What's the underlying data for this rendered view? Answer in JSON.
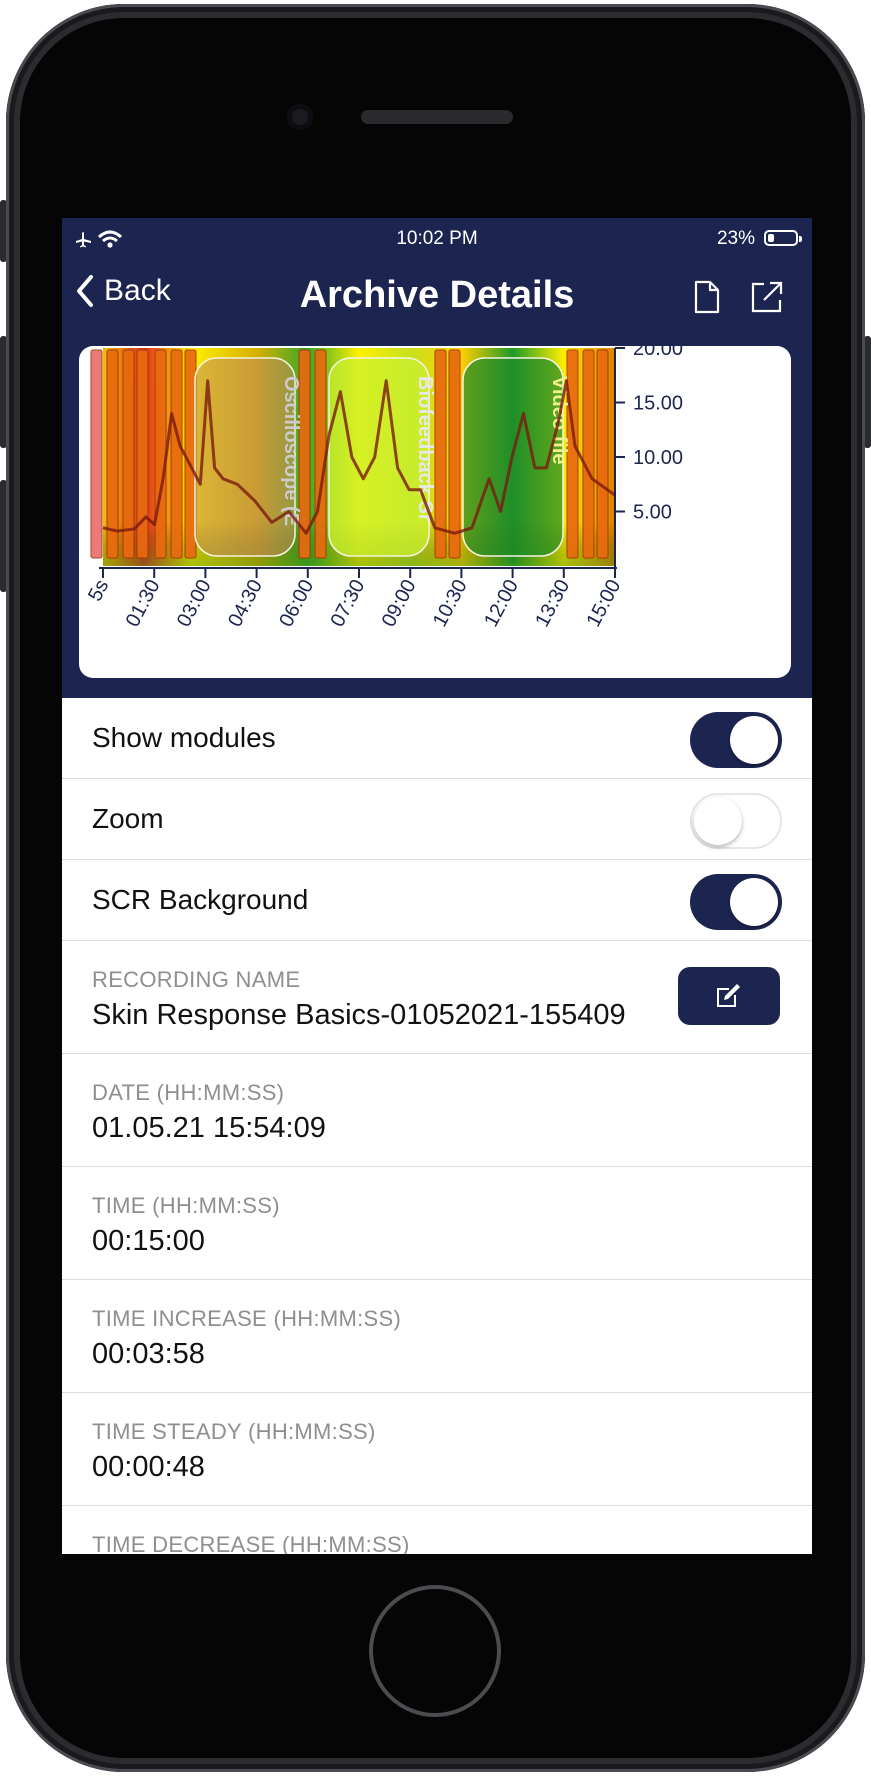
{
  "status": {
    "time": "10:02 PM",
    "battery_pct": "23%",
    "battery_level": 0.23
  },
  "navbar": {
    "back_label": "Back",
    "title": "Archive Details"
  },
  "chart_data": {
    "type": "line",
    "x_tick_labels": [
      "5s",
      "01:30",
      "03:00",
      "04:30",
      "06:00",
      "07:30",
      "09:00",
      "10:30",
      "12:00",
      "13:30",
      "15:00"
    ],
    "y_tick_labels": [
      "20.00",
      "15.00",
      "10.00",
      "5.00"
    ],
    "ylim": [
      0,
      20
    ],
    "xlim_seconds": [
      5,
      900
    ],
    "modules": [
      "Oscilloscope (E",
      "Biofeedback Sr",
      "Video file"
    ],
    "series": [
      {
        "points": [
          [
            5,
            3.5
          ],
          [
            30,
            3.2
          ],
          [
            60,
            3.4
          ],
          [
            80,
            4.5
          ],
          [
            95,
            3.8
          ],
          [
            110,
            8
          ],
          [
            125,
            14
          ],
          [
            140,
            11
          ],
          [
            160,
            9
          ],
          [
            175,
            7.5
          ],
          [
            188,
            17
          ],
          [
            200,
            9
          ],
          [
            215,
            8
          ],
          [
            240,
            7.5
          ],
          [
            270,
            6
          ],
          [
            300,
            4
          ],
          [
            330,
            5
          ],
          [
            360,
            3
          ],
          [
            380,
            5
          ],
          [
            400,
            12
          ],
          [
            420,
            16
          ],
          [
            440,
            10
          ],
          [
            460,
            8
          ],
          [
            480,
            10
          ],
          [
            500,
            17
          ],
          [
            520,
            9
          ],
          [
            540,
            7
          ],
          [
            560,
            7
          ],
          [
            585,
            3.5
          ],
          [
            620,
            3
          ],
          [
            650,
            3.5
          ],
          [
            680,
            8
          ],
          [
            700,
            5
          ],
          [
            720,
            10
          ],
          [
            740,
            14
          ],
          [
            760,
            9
          ],
          [
            780,
            9
          ],
          [
            800,
            13
          ],
          [
            815,
            17
          ],
          [
            830,
            11
          ],
          [
            860,
            8
          ],
          [
            900,
            6.5
          ]
        ]
      }
    ]
  },
  "toggles": [
    {
      "label": "Show modules",
      "on": true
    },
    {
      "label": "Zoom",
      "on": false
    },
    {
      "label": "SCR Background",
      "on": true
    }
  ],
  "recording": {
    "caption": "RECORDING NAME",
    "value": "Skin Response Basics-01052021-155409"
  },
  "details": [
    {
      "caption": "DATE (HH:MM:SS)",
      "value": "01.05.21 15:54:09"
    },
    {
      "caption": "TIME (HH:MM:SS)",
      "value": "00:15:00"
    },
    {
      "caption": "TIME INCREASE (HH:MM:SS)",
      "value": "00:03:58"
    },
    {
      "caption": "TIME STEADY (HH:MM:SS)",
      "value": "00:00:48"
    },
    {
      "caption": "TIME DECREASE (HH:MM:SS)",
      "value": ""
    }
  ],
  "colors": {
    "primary": "#1c2550",
    "separator": "#dcdcdf",
    "caption": "#8e8e93"
  }
}
